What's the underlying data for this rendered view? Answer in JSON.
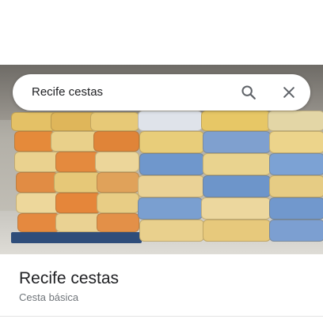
{
  "search": {
    "query": "Recife cestas"
  },
  "place": {
    "name": "Recife cestas",
    "category": "Cesta básica"
  },
  "icons": {
    "search": "search-icon",
    "close": "close-icon"
  },
  "colors": {
    "bag_yellow": "#e8c55a",
    "bag_orange": "#e58a3a",
    "bag_blue": "#4a78b8",
    "pallet_blue": "#2f4d7a"
  }
}
